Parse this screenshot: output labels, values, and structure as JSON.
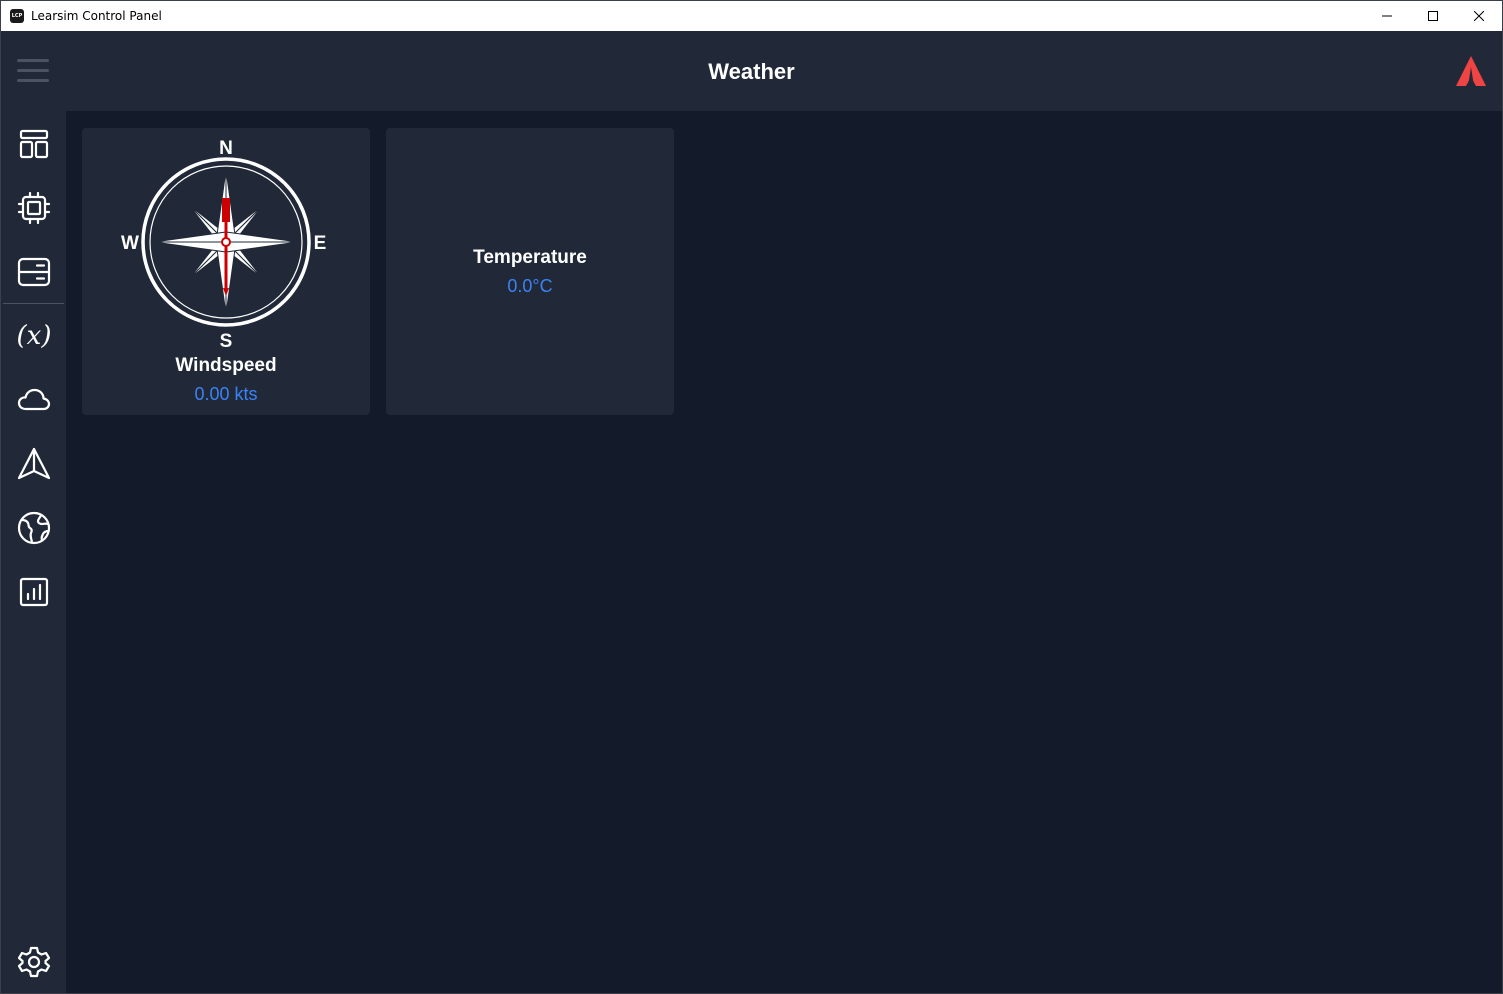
{
  "window": {
    "title": "Learsim Control Panel",
    "app_icon_text": "LCP"
  },
  "header": {
    "title": "Weather"
  },
  "sidebar": {
    "items": [
      {
        "icon": "layout-icon"
      },
      {
        "icon": "chip-icon"
      },
      {
        "icon": "server-icon"
      },
      {
        "icon": "variable-icon"
      },
      {
        "icon": "cloud-icon"
      },
      {
        "icon": "navigation-icon"
      },
      {
        "icon": "globe-icon"
      },
      {
        "icon": "chart-icon"
      },
      {
        "icon": "gear-icon"
      }
    ]
  },
  "wind": {
    "compass": {
      "n": "N",
      "s": "S",
      "e": "E",
      "w": "W"
    },
    "label": "Windspeed",
    "value": "0.00 kts"
  },
  "temperature": {
    "label": "Temperature",
    "value": "0.0°C"
  },
  "colors": {
    "background": "#131a29",
    "panel": "#212938",
    "accent": "#3b82f6",
    "brand": "#ef4444",
    "needle": "#cc0000"
  }
}
